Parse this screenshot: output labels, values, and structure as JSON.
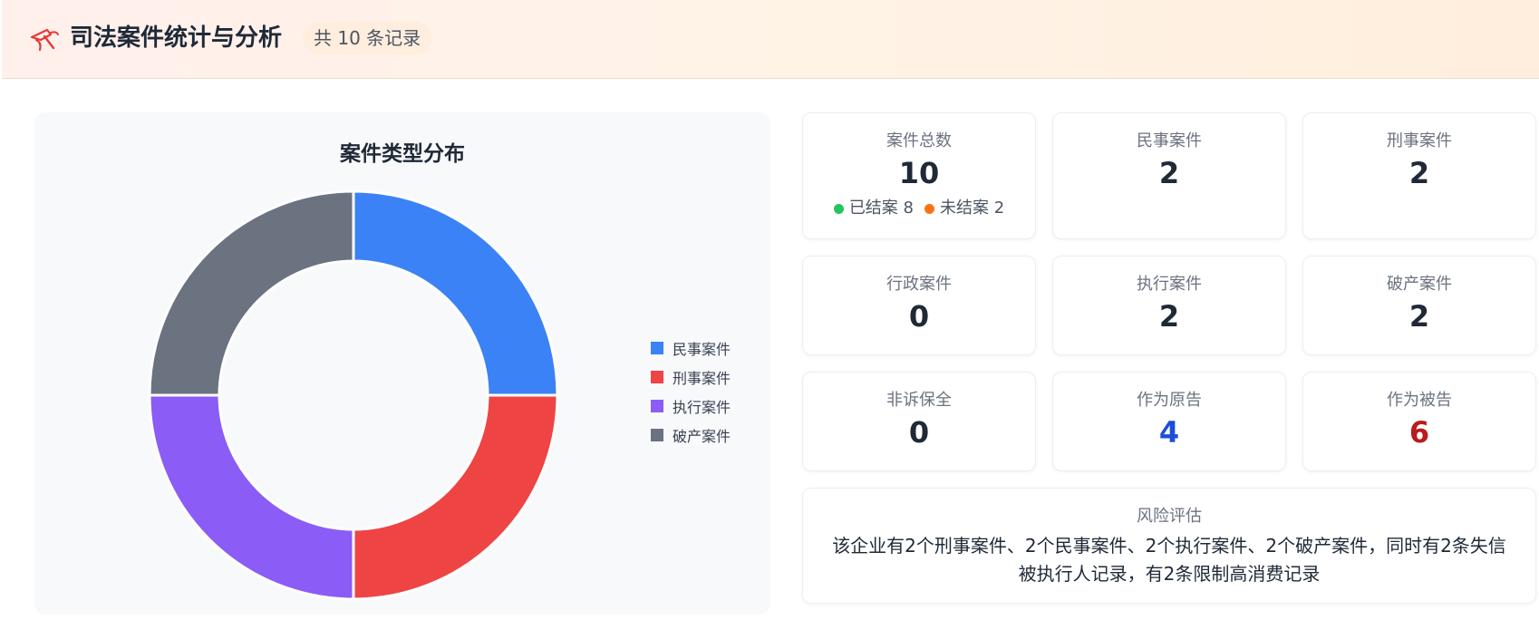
{
  "header": {
    "title": "司法案件统计与分析",
    "record_count": "共 10 条记录"
  },
  "chart_data": {
    "type": "pie",
    "title": "案件类型分布",
    "categories": [
      "民事案件",
      "刑事案件",
      "执行案件",
      "破产案件"
    ],
    "values": [
      2,
      2,
      2,
      2
    ],
    "colors": [
      "#3b82f6",
      "#ef4444",
      "#8b5cf6",
      "#6b7280"
    ],
    "legend_position": "right"
  },
  "stats": {
    "total": {
      "label": "案件总数",
      "value": "10",
      "closed_label": "已结案 8",
      "open_label": "未结案 2",
      "closed_color": "#22c55e",
      "open_color": "#f97316"
    },
    "civil": {
      "label": "民事案件",
      "value": "2"
    },
    "criminal": {
      "label": "刑事案件",
      "value": "2"
    },
    "administrative": {
      "label": "行政案件",
      "value": "0"
    },
    "execution": {
      "label": "执行案件",
      "value": "2"
    },
    "bankruptcy": {
      "label": "破产案件",
      "value": "2"
    },
    "non_litigation": {
      "label": "非诉保全",
      "value": "0"
    },
    "as_plaintiff": {
      "label": "作为原告",
      "value": "4",
      "color": "#1d4ed8"
    },
    "as_defendant": {
      "label": "作为被告",
      "value": "6",
      "color": "#b91c1c"
    }
  },
  "risk": {
    "label": "风险评估",
    "text": "该企业有2个刑事案件、2个民事案件、2个执行案件、2个破产案件，同时有2条失信被执行人记录，有2条限制高消费记录"
  },
  "icons": {
    "logo": "gavel-icon",
    "logo_color": "#e53935"
  }
}
